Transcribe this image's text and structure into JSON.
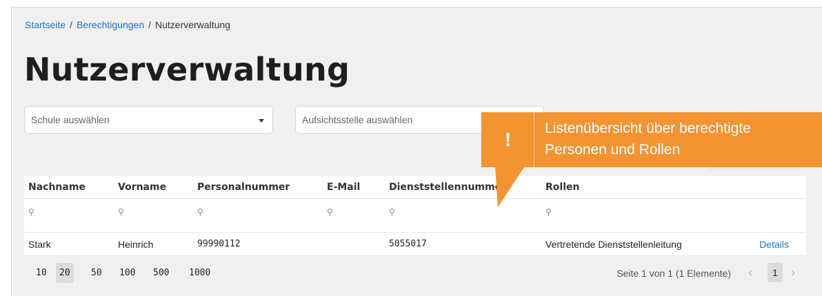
{
  "breadcrumb": {
    "home": "Startseite",
    "sep1": "/",
    "permissions": "Berechtigungen",
    "sep2": "/",
    "current": "Nutzerverwaltung"
  },
  "page_title": "Nutzerverwaltung",
  "filters": {
    "school_placeholder": "Schule auswählen",
    "authority_placeholder": "Aufsichtsstelle auswählen"
  },
  "table": {
    "columns": [
      "Nachname",
      "Vorname",
      "Personalnummer",
      "E-Mail",
      "Dienststellennummer",
      "Rollen"
    ],
    "search_icon": "⚲",
    "rows": [
      {
        "nachname": "Stark",
        "vorname": "Heinrich",
        "personalnummer": "99990112",
        "email": "",
        "dienststellennummer": "5055017",
        "rollen": "Vertretende Dienststellenleitung",
        "action": "Details"
      }
    ]
  },
  "pager": {
    "sizes": [
      "10",
      "20",
      "50",
      "100",
      "500",
      "1000"
    ],
    "active_size": "20",
    "info": "Seite 1 von 1 (1 Elemente)",
    "prev": "‹",
    "next": "›",
    "current_page": "1"
  },
  "callout": {
    "icon": "!",
    "line1": "Listenübersicht über berechtigte",
    "line2": "Personen und Rollen",
    "color": "#f39331"
  },
  "colors": {
    "link": "#1a73c9",
    "background": "#f0f0f0"
  }
}
